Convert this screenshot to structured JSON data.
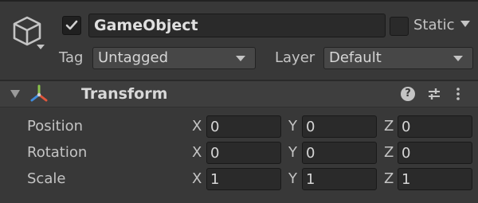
{
  "header": {
    "active_checked": true,
    "name": "GameObject",
    "static_label": "Static",
    "tag_label": "Tag",
    "tag_value": "Untagged",
    "layer_label": "Layer",
    "layer_value": "Default"
  },
  "component": {
    "title": "Transform",
    "help_glyph": "?",
    "rows": [
      {
        "label": "Position",
        "x": "0",
        "y": "0",
        "z": "0"
      },
      {
        "label": "Rotation",
        "x": "0",
        "y": "0",
        "z": "0"
      },
      {
        "label": "Scale",
        "x": "1",
        "y": "1",
        "z": "1"
      }
    ],
    "axis_labels": {
      "x": "X",
      "y": "Y",
      "z": "Z"
    }
  },
  "colors": {
    "background": "#383838",
    "field": "#2a2a2a",
    "axis_red": "#e0563c",
    "axis_green": "#8bc34a",
    "axis_blue": "#3f8cde"
  },
  "icons": [
    "gameobject-cube-icon",
    "checkmark-icon",
    "dropdown-caret-icon",
    "foldout-triangle-icon",
    "transform-axes-icon",
    "help-icon",
    "presets-icon",
    "kebab-menu-icon"
  ]
}
